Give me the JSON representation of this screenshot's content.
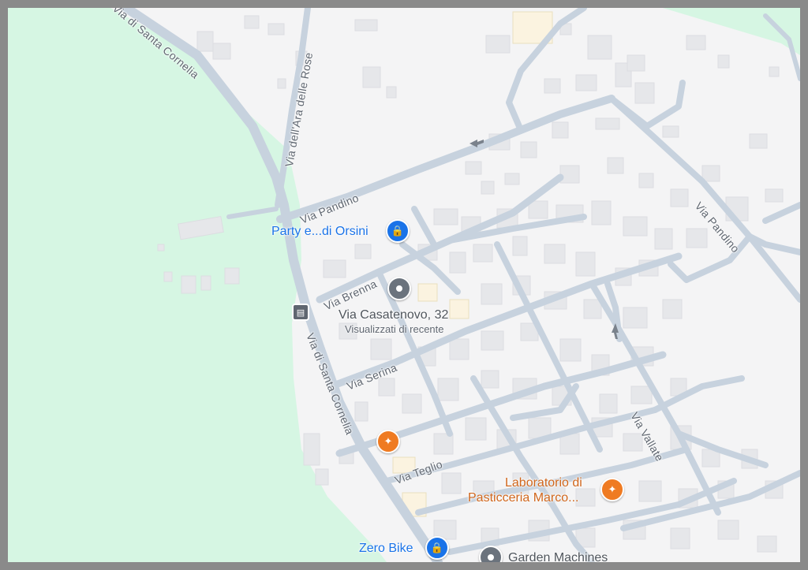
{
  "map": {
    "colors": {
      "land": "#f4f4f5",
      "park": "#d6f6e3",
      "road": "#c7d2de",
      "building": "#e6e7ea",
      "frame": "#8a8a8a"
    },
    "roads": {
      "via_di_santa_cornelia_top": "Via di Santa Cornelia",
      "via_di_santa_cornelia_bottom": "Via di Santa Cornelia",
      "via_ara_delle_rose": "Via dell'Ara delle Rose",
      "via_pandino_left": "Via Pandino",
      "via_pandino_right": "Via Pandino",
      "via_brenna": "Via Brenna",
      "via_serina": "Via Serina",
      "via_teglio": "Via Teglio",
      "via_vallate": "Via Vallate"
    },
    "places": {
      "party": {
        "name": "Party e...di Orsini",
        "icon": "shopping-bag-icon"
      },
      "casatenovo": {
        "name": "Via Casatenovo, 32",
        "subtitle": "Visualizzati di recente",
        "icon": "location-pin-icon"
      },
      "restaurant": {
        "icon": "restaurant-icon"
      },
      "laboratorio": {
        "name_line1": "Laboratorio di",
        "name_line2": "Pasticceria Marco...",
        "icon": "restaurant-icon"
      },
      "zero_bike": {
        "name": "Zero Bike",
        "icon": "shopping-bag-icon"
      },
      "garden_machines": {
        "name": "Garden Machines",
        "icon": "location-pin-icon"
      }
    },
    "transit": {
      "icon": "bus-stop-icon"
    }
  }
}
